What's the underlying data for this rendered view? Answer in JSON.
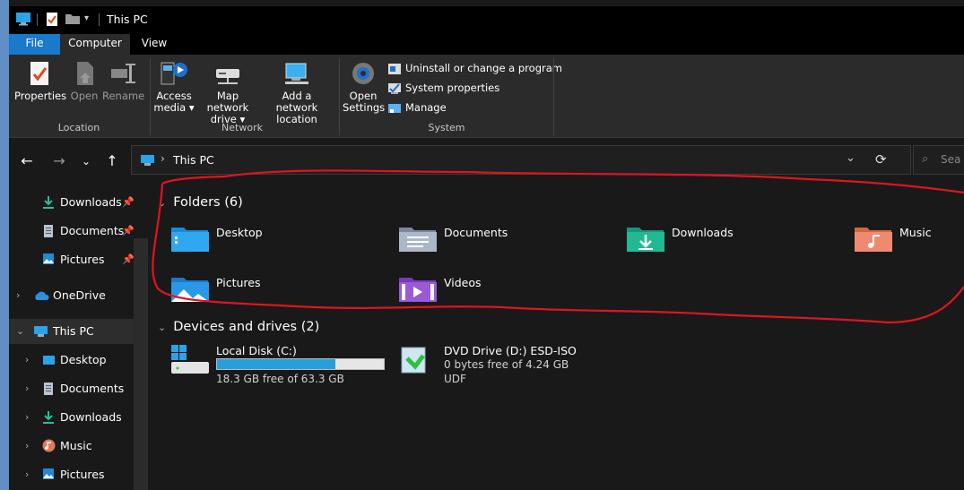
{
  "titlebar": {
    "title": "This PC"
  },
  "tabs": [
    "File",
    "Computer",
    "View"
  ],
  "ribbon": {
    "location": {
      "properties": "Properties",
      "open": "Open",
      "rename": "Rename",
      "label": "Location"
    },
    "network": {
      "access_media_1": "Access",
      "access_media_2": "media ▾",
      "map_drive_1": "Map network",
      "map_drive_2": "drive ▾",
      "add_location_1": "Add a network",
      "add_location_2": "location",
      "label": "Network"
    },
    "system": {
      "open_settings_1": "Open",
      "open_settings_2": "Settings",
      "uninstall": "Uninstall or change a program",
      "sys_props": "System properties",
      "manage": "Manage",
      "label": "System"
    }
  },
  "address": {
    "path": "This PC",
    "search_placeholder": "Sea"
  },
  "sidebar": {
    "quick": [
      {
        "label": "Downloads"
      },
      {
        "label": "Documents"
      },
      {
        "label": "Pictures"
      }
    ],
    "onedrive": "OneDrive",
    "thispc": "This PC",
    "thispc_children": [
      {
        "label": "Desktop"
      },
      {
        "label": "Documents"
      },
      {
        "label": "Downloads"
      },
      {
        "label": "Music"
      },
      {
        "label": "Pictures"
      }
    ]
  },
  "content": {
    "folders_header": "Folders (6)",
    "folders": [
      {
        "label": "Desktop"
      },
      {
        "label": "Documents"
      },
      {
        "label": "Downloads"
      },
      {
        "label": "Music"
      },
      {
        "label": "Pictures"
      },
      {
        "label": "Videos"
      }
    ],
    "drives_header": "Devices and drives (2)",
    "drives": [
      {
        "label": "Local Disk (C:)",
        "free": "18.3 GB free of 63.3 GB",
        "used_fraction": 0.71
      },
      {
        "label": "DVD Drive (D:) ESD-ISO",
        "free": "0 bytes free of 4.24 GB",
        "fs": "UDF"
      }
    ]
  },
  "colors": {
    "accent": "#1979ca",
    "annotation": "#e0141e",
    "background": "#191919"
  }
}
